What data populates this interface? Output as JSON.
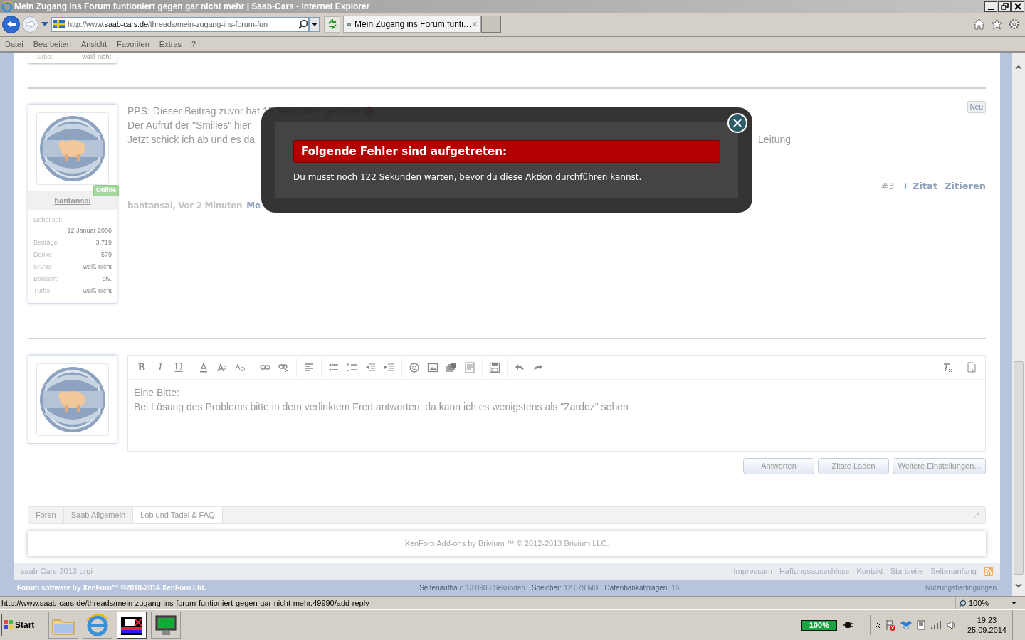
{
  "browser": {
    "title": "Mein Zugang ins Forum funtioniert gegen gar nicht mehr | Saab-Cars - Internet Explorer",
    "url_parts": [
      "http://www.",
      "saab-cars.de",
      "/threads/mein-zugang-ins-forum-fun"
    ],
    "tab": {
      "title": "Mein Zugang ins Forum funti…",
      "close": "×"
    },
    "menu": [
      "Datei",
      "Bearbeiten",
      "Ansicht",
      "Favoriten",
      "Extras",
      "?"
    ]
  },
  "previous_post": {
    "stats": [
      {
        "label": "Turbo:",
        "value": "weiß nicht"
      }
    ]
  },
  "post": {
    "username": "bantansai",
    "online": "Online",
    "stats": [
      {
        "label": "Dabei seit:",
        "value": "12 Januar 2006",
        "wide": true
      },
      {
        "label": "Beiträge:",
        "value": "3,719"
      },
      {
        "label": "Danke:",
        "value": "579"
      },
      {
        "label": "SAAB:",
        "value": "weiß nicht"
      },
      {
        "label": "Baujahr:",
        "value": "div."
      },
      {
        "label": "Turbo:",
        "value": "weiß nicht"
      }
    ],
    "lines": [
      [
        "PPS: Dieser Beitrag zuvor hat 15 Sekunden gedauert"
      ],
      [
        "Der Aufruf der \"Smilies\" hier"
      ],
      [
        "Jetzt schick ich ab und es da",
        "Leitung"
      ]
    ],
    "new_badge": "Neu",
    "author_date": "bantansai, Vor 2 Minuten",
    "report": "Me",
    "number": "#3",
    "plus_quote": "+ Zitat",
    "quote": "Zitieren"
  },
  "modal": {
    "heading": "Folgende Fehler sind aufgetreten:",
    "message": "Du musst noch 122 Sekunden warten, bevor du diese Aktion durchführen kannst."
  },
  "editor": {
    "format_buttons": [
      "B",
      "I",
      "U"
    ],
    "lines": [
      "Eine Bitte:",
      "Bei Lösung des Problems bitte in dem verlinktem Fred antworten, da kann ich es wenigstens als \"Zardoz\" sehen"
    ],
    "buttons": [
      "Antworten",
      "Zitate Laden",
      "Weitere Einstellungen..."
    ]
  },
  "breadcrumb": [
    {
      "label": "Foren",
      "selected": false
    },
    {
      "label": "Saab Allgemein",
      "selected": false
    },
    {
      "label": "Lob und Tadel & FAQ",
      "selected": true
    }
  ],
  "copyright": "XenForo Add-ons by Brivium ™ © 2012-2013 Brivium LLC.",
  "footer": {
    "style": "saab-Cars-2013-orgi",
    "links": [
      "Impressum",
      "Haftungsausschluss",
      "Kontakt",
      "Startseite",
      "Seitenanfang"
    ],
    "software": "Forum software by XenForo™ ©2010-2014 XenForo Ltd.",
    "debug": [
      {
        "label": "Seitenaufbau:",
        "value": "13.0903 Sekunden"
      },
      {
        "label": "Speicher:",
        "value": "12.079 MB"
      },
      {
        "label": "Datenbankabfragen:",
        "value": "16"
      }
    ],
    "terms": "Nutzungsbedingungen"
  },
  "status_bar": {
    "url": "http://www.saab-cars.de/threads/mein-zugang-ins-forum-funtioniert-gegen-gar-nicht-mehr.49990/add-reply",
    "zoom": "100%"
  },
  "taskbar": {
    "start": "Start",
    "battery": "100%",
    "time": "19:23",
    "date": "25.09.2014"
  }
}
